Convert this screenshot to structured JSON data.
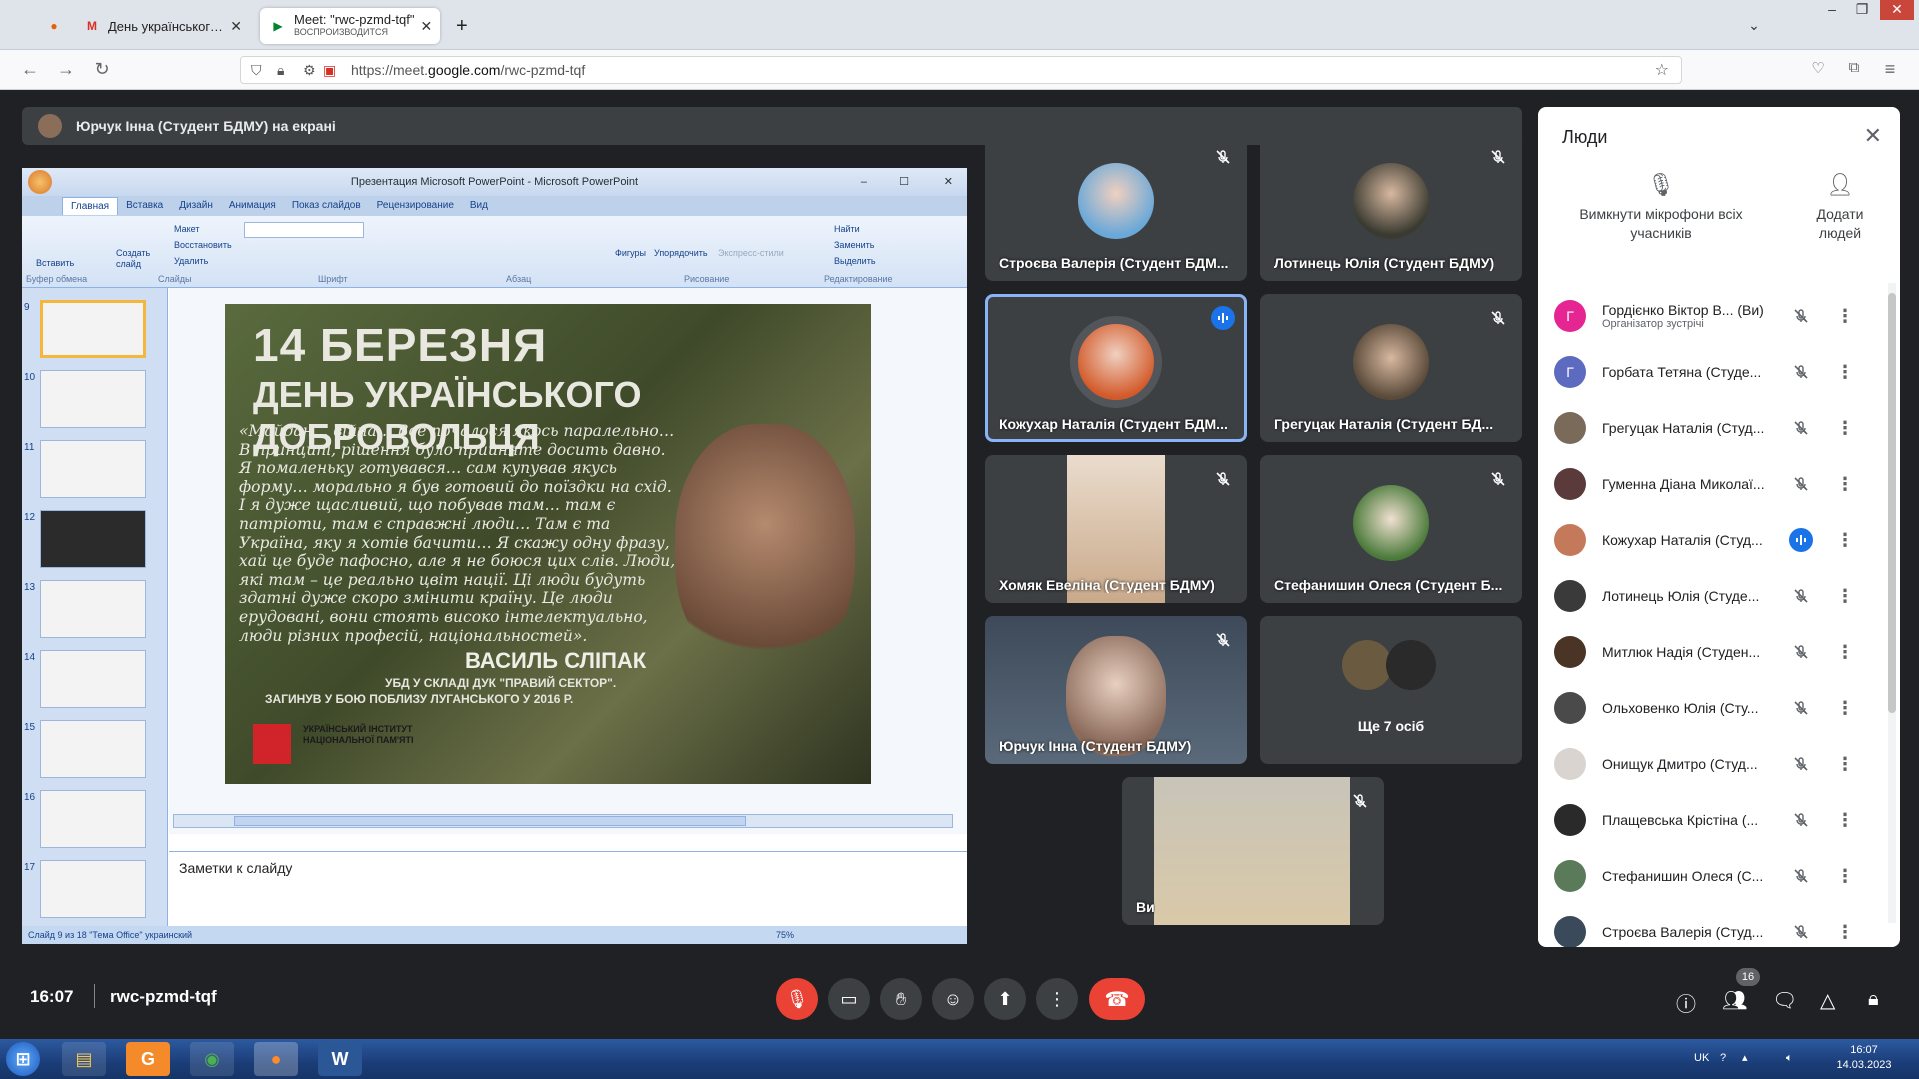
{
  "browser": {
    "tabs": [
      {
        "title": "День українського добровольця",
        "icon": "gmail"
      },
      {
        "title": "Meet: \"rwc-pzmd-tqf\"",
        "subtitle": "ВОСПРОИЗВОДИТСЯ",
        "icon": "meet"
      }
    ],
    "url_prefix": "https://meet.",
    "url_domain": "google.com",
    "url_path": "/rwc-pzmd-tqf"
  },
  "meet": {
    "presenter_bar": "Юрчук Інна (Студент БДМУ) на екрані",
    "powerpoint": {
      "window_title": "Презентация Microsoft PowerPoint - Microsoft PowerPoint",
      "tabs": [
        "Главная",
        "Вставка",
        "Дизайн",
        "Анимация",
        "Показ слайдов",
        "Рецензирование",
        "Вид"
      ],
      "ribbon": {
        "paste": "Вставить",
        "new_slide": "Создать слайд",
        "layout": "Макет",
        "reset": "Восстановить",
        "delete": "Удалить",
        "shapes": "Фигуры",
        "arrange": "Упорядочить",
        "quick_styles": "Экспресс-стили",
        "find": "Найти",
        "replace": "Заменить",
        "select": "Выделить",
        "groups": [
          "Буфер обмена",
          "Слайды",
          "Шрифт",
          "Абзац",
          "Рисование",
          "Редактирование"
        ]
      },
      "thumb_numbers": [
        "9",
        "10",
        "11",
        "12",
        "13",
        "14",
        "15",
        "16",
        "17"
      ],
      "slide": {
        "line1": "14 БЕРЕЗНЯ",
        "line2": "ДЕНЬ УКРАЇНСЬКОГО ДОБРОВОЛЬЦЯ",
        "quote": "«Майдан… війна… Все почалося якось паралельно… В принципі, рішення було прийняте досить давно. Я помаленьку готувався… сам купував якусь форму… морально я був готовий до поїздки на схід. І я дуже щасливий, що побував там… там є патріоти, там є справжні люди… Там є та Україна, яку я хотів бачити… Я скажу одну фразу, хай це буде пафосно, але я не боюся цих слів. Люди, які там – це реально цвіт нації. Ці люди будуть здатні дуже скоро змінити країну. Це люди ерудовані, вони стоять високо інтелектуально, люди різних професій, національностей».",
        "author": "ВАСИЛЬ СЛІПАК",
        "role": "УБД У СКЛАДІ ДУК \"ПРАВИЙ СЕКТОР\".",
        "died": "ЗАГИНУВ У БОЮ ПОБЛИЗУ ЛУГАНСЬКОГО У 2016 Р.",
        "org": "УКРАЇНСЬКИЙ ІНСТИТУТ НАЦІОНАЛЬНОЇ ПАМ'ЯТІ"
      },
      "notes_placeholder": "Заметки к слайду",
      "status": "Слайд 9 из 18    \"Тема Office\"    украинский",
      "zoom": "75%"
    },
    "tiles": [
      {
        "name": "Строєва Валерія (Студент БДМ...",
        "muted": true
      },
      {
        "name": "Лотинець Юлія (Студент БДМУ)",
        "muted": true
      },
      {
        "name": "Кожухар Наталія (Студент БДМ...",
        "muted": false,
        "speaking": true
      },
      {
        "name": "Грегуцак Наталія (Студент БД...",
        "muted": true
      },
      {
        "name": "Хомяк Евеліна (Студент БДМУ)",
        "muted": true
      },
      {
        "name": "Стефанишин Олеся (Студент Б...",
        "muted": true
      },
      {
        "name": "Юрчук Інна (Студент БДМУ)",
        "muted": true
      },
      {
        "name": "Ще 7 осіб",
        "muted": false
      },
      {
        "name": "Ви",
        "muted": true
      }
    ],
    "people_panel": {
      "title": "Люди",
      "mute_all": "Вимкнути мікрофони всіх учасників",
      "add_people": "Додати людей",
      "participants": [
        {
          "name": "Гордієнко Віктор В...",
          "you": "(Ви)",
          "sub": "Організатор зустрічі",
          "initial": "Г",
          "color": "#e52592",
          "mic": "off"
        },
        {
          "name": "Горбата Тетяна (Студе...",
          "initial": "Г",
          "color": "#5c6bc0",
          "mic": "off"
        },
        {
          "name": "Грегуцак Наталія (Студ...",
          "initial": "",
          "color": "#7a6a5a",
          "mic": "off"
        },
        {
          "name": "Гуменна Діана Миколаї...",
          "initial": "",
          "color": "#5a3a3a",
          "mic": "off"
        },
        {
          "name": "Кожухар Наталія (Студ...",
          "initial": "",
          "color": "#c47a5a",
          "mic": "on"
        },
        {
          "name": "Лотинець Юлія (Студе...",
          "initial": "",
          "color": "#3a3a3a",
          "mic": "off"
        },
        {
          "name": "Митлюк Надія (Студен...",
          "initial": "",
          "color": "#4a3426",
          "mic": "off"
        },
        {
          "name": "Ольховенко Юлія (Сту...",
          "initial": "",
          "color": "#4a4a4a",
          "mic": "off"
        },
        {
          "name": "Онищук Дмитро (Студ...",
          "initial": "",
          "color": "#d9d4cf",
          "mic": "off"
        },
        {
          "name": "Плащевська Крістіна (...",
          "initial": "",
          "color": "#2a2a2a",
          "mic": "off"
        },
        {
          "name": "Стефанишин Олеся (С...",
          "initial": "",
          "color": "#5a7a5a",
          "mic": "off"
        },
        {
          "name": "Строєва Валерія (Студ...",
          "initial": "",
          "color": "#3a4a5a",
          "mic": "off"
        }
      ]
    },
    "bottom": {
      "time": "16:07",
      "code": "rwc-pzmd-tqf",
      "people_count": "16"
    }
  },
  "taskbar": {
    "lang": "UK",
    "time": "16:07",
    "date": "14.03.2023"
  }
}
